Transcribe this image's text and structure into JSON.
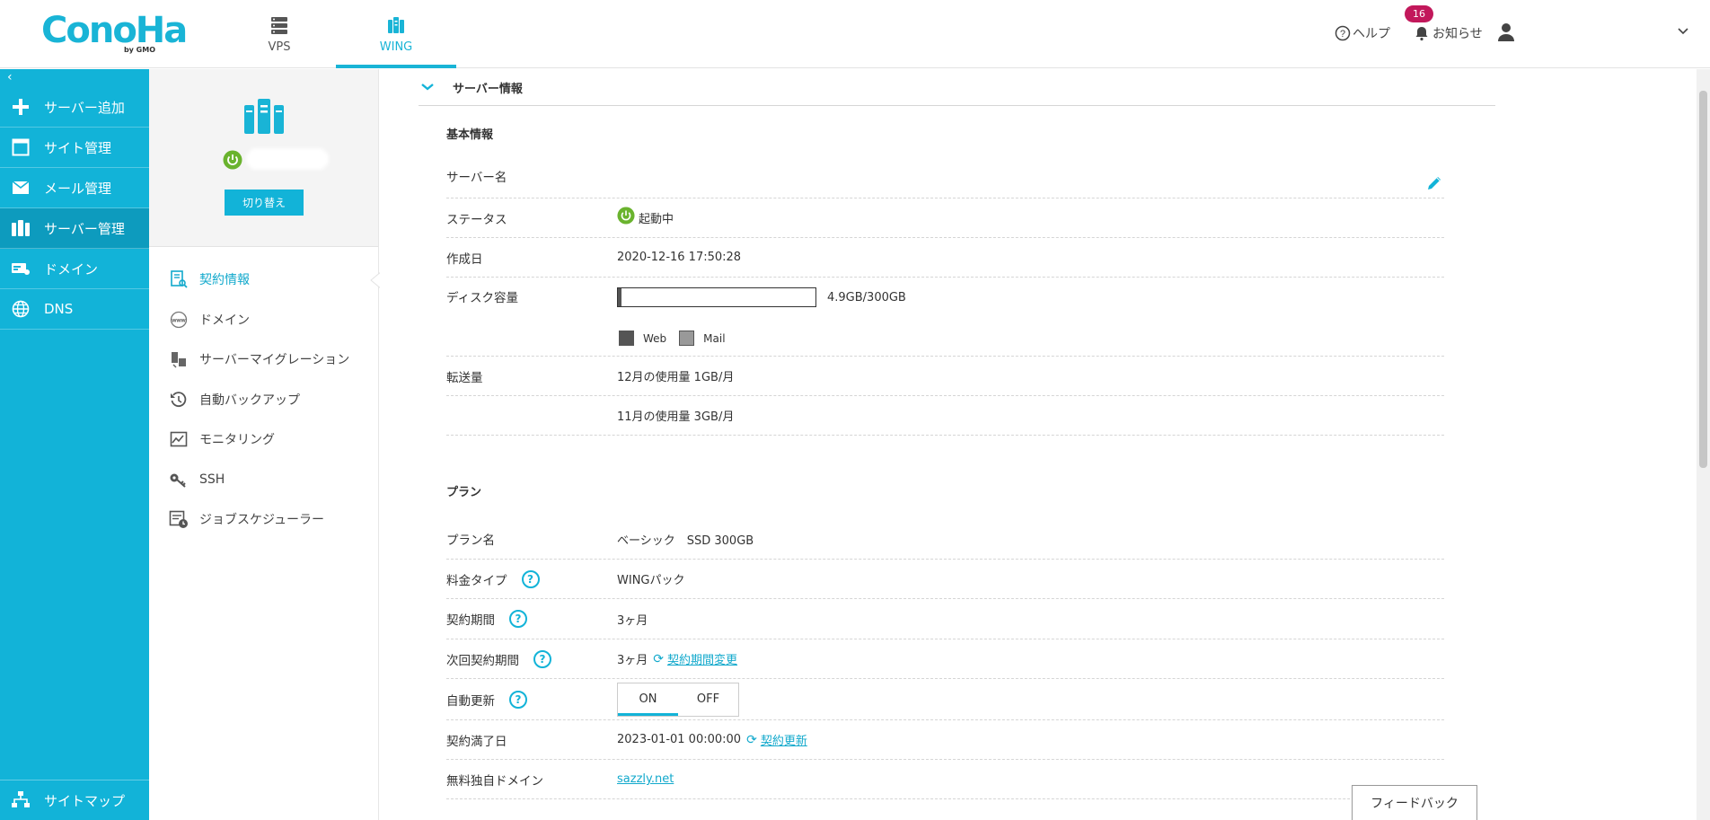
{
  "header": {
    "logo_text": "ConoHa",
    "logo_sub": "by GMO",
    "tabs": [
      {
        "label": "VPS",
        "icon": "vps-server-icon"
      },
      {
        "label": "WING",
        "icon": "wing-server-icon"
      }
    ],
    "help_label": "ヘルプ",
    "notice_label": "お知らせ",
    "notice_count": "16"
  },
  "sidebar": {
    "collapse_glyph": "‹",
    "items": [
      {
        "label": "サーバー追加",
        "icon": "plus-icon"
      },
      {
        "label": "サイト管理",
        "icon": "window-icon"
      },
      {
        "label": "メール管理",
        "icon": "mail-icon"
      },
      {
        "label": "サーバー管理",
        "icon": "server-icon"
      },
      {
        "label": "ドメイン",
        "icon": "domain-card-icon"
      },
      {
        "label": "DNS",
        "icon": "globe-icon"
      }
    ],
    "bottom_label": "サイトマップ"
  },
  "subpanel": {
    "switch_label": "切り替え",
    "menu": [
      {
        "label": "契約情報",
        "icon": "contract-icon"
      },
      {
        "label": "ドメイン",
        "icon": "www-icon"
      },
      {
        "label": "サーバーマイグレーション",
        "icon": "migration-icon"
      },
      {
        "label": "自動バックアップ",
        "icon": "backup-icon"
      },
      {
        "label": "モニタリング",
        "icon": "monitoring-icon"
      },
      {
        "label": "SSH",
        "icon": "key-icon"
      },
      {
        "label": "ジョブスケジューラー",
        "icon": "scheduler-icon"
      }
    ]
  },
  "main": {
    "section_title": "サーバー情報",
    "basic": {
      "title": "基本情報",
      "server_name_label": "サーバー名",
      "status_label": "ステータス",
      "status_value": "起動中",
      "created_label": "作成日",
      "created_value": "2020-12-16 17:50:28",
      "disk_label": "ディスク容量",
      "disk_value": "4.9GB/300GB",
      "disk_used_fraction": 0.016,
      "legend_web": "Web",
      "legend_mail": "Mail",
      "transfer_label": "転送量",
      "transfer_dec": "12月の使用量 1GB/月",
      "transfer_nov": "11月の使用量 3GB/月"
    },
    "plan": {
      "title": "プラン",
      "plan_name_label": "プラン名",
      "plan_name_value": "ベーシック　SSD 300GB",
      "fee_type_label": "料金タイプ",
      "fee_type_value": "WINGパック",
      "period_label": "契約期間",
      "period_value": "3ヶ月",
      "next_period_label": "次回契約期間",
      "next_period_value": "3ヶ月",
      "next_period_link": "契約期間変更",
      "auto_renew_label": "自動更新",
      "toggle_on": "ON",
      "toggle_off": "OFF",
      "expiry_label": "契約満了日",
      "expiry_value": "2023-01-01 00:00:00",
      "expiry_link": "契約更新",
      "free_domain_label": "無料独自ドメイン",
      "free_domain_value": "sazzly.net",
      "help_glyph": "?"
    },
    "feedback_label": "フィードバック"
  },
  "colors": {
    "brand": "#12b3d8",
    "sidebar_active": "#0d9bbe",
    "status_green": "#6ab32e",
    "badge": "#c2185b"
  }
}
